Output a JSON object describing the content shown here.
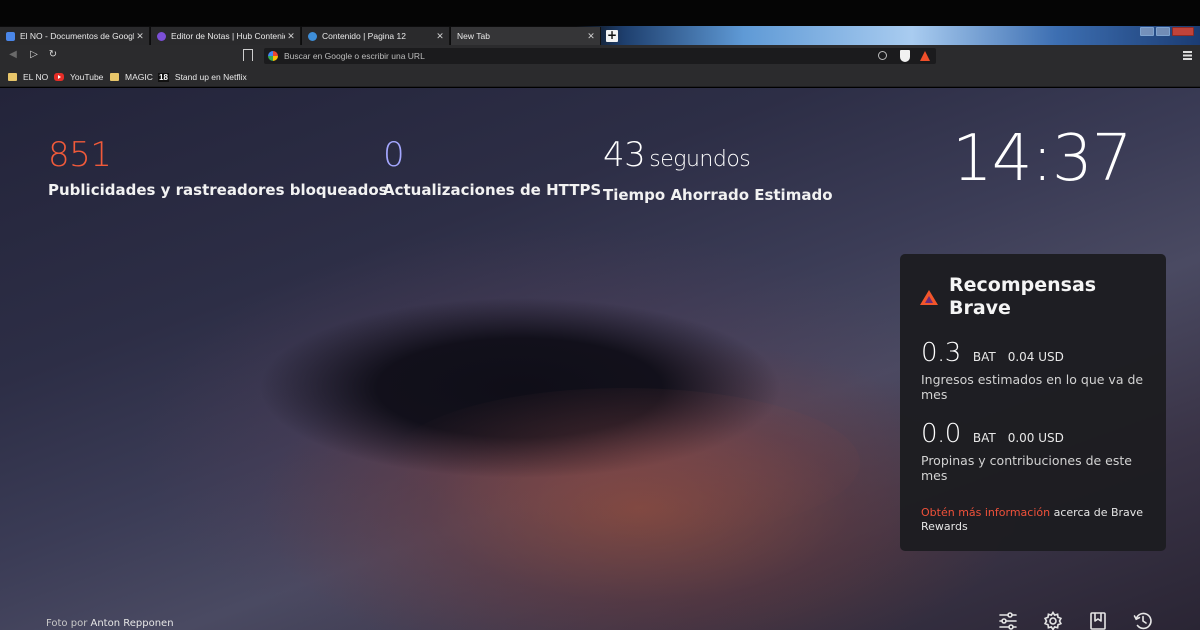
{
  "tabs": [
    {
      "title": "El NO - Documentos de Google",
      "icon": "google-docs-icon",
      "color": "#4a86e8",
      "active": false
    },
    {
      "title": "Editor de Notas | Hub Contenidos",
      "icon": "hub-icon",
      "color": "#7b4fd6",
      "active": false
    },
    {
      "title": "Contenido | Pagina 12",
      "icon": "pagina12-icon",
      "color": "#3e8ed8",
      "active": false
    },
    {
      "title": "New Tab",
      "icon": "",
      "color": "",
      "active": true
    }
  ],
  "toolbar": {
    "url_placeholder": "Buscar en Google o escribir una URL"
  },
  "bookmarks": [
    {
      "label": "EL NO",
      "icon": "folder-icon"
    },
    {
      "label": "YouTube",
      "icon": "youtube-icon"
    },
    {
      "label": "MAGIC",
      "icon": "folder-icon"
    },
    {
      "label": "Stand up en Netflix",
      "icon": "rating-18-icon",
      "badge": "18"
    }
  ],
  "stats": {
    "ads_blocked": {
      "value": "851",
      "label": "Publicidades y rastreadores bloqueados",
      "color": "#f15a3a"
    },
    "https_upgrades": {
      "value": "0",
      "label": "Actualizaciones de HTTPS",
      "color": "#a4a7ff"
    },
    "time_saved": {
      "value": "43",
      "unit": "segundos",
      "label": "Tiempo Ahorrado Estimado",
      "color": "#ffffff"
    }
  },
  "clock": {
    "time": "14:37"
  },
  "rewards": {
    "title": "Recompensas Brave",
    "earnings": {
      "amount": "0.3",
      "currency": "BAT",
      "usd": "0.04 USD",
      "label": "Ingresos estimados en lo que va de mes"
    },
    "tips": {
      "amount": "0.0",
      "currency": "BAT",
      "usd": "0.00 USD",
      "label": "Propinas y contribuciones de este mes"
    },
    "learn_more_link": "Obtén más información",
    "learn_more_rest": " acerca de Brave Rewards"
  },
  "photo_credit": {
    "prefix": "Foto por ",
    "author": "Anton Repponen"
  },
  "bottom_actions": [
    "customize-icon",
    "settings-icon",
    "bookmarks-icon",
    "history-icon"
  ]
}
